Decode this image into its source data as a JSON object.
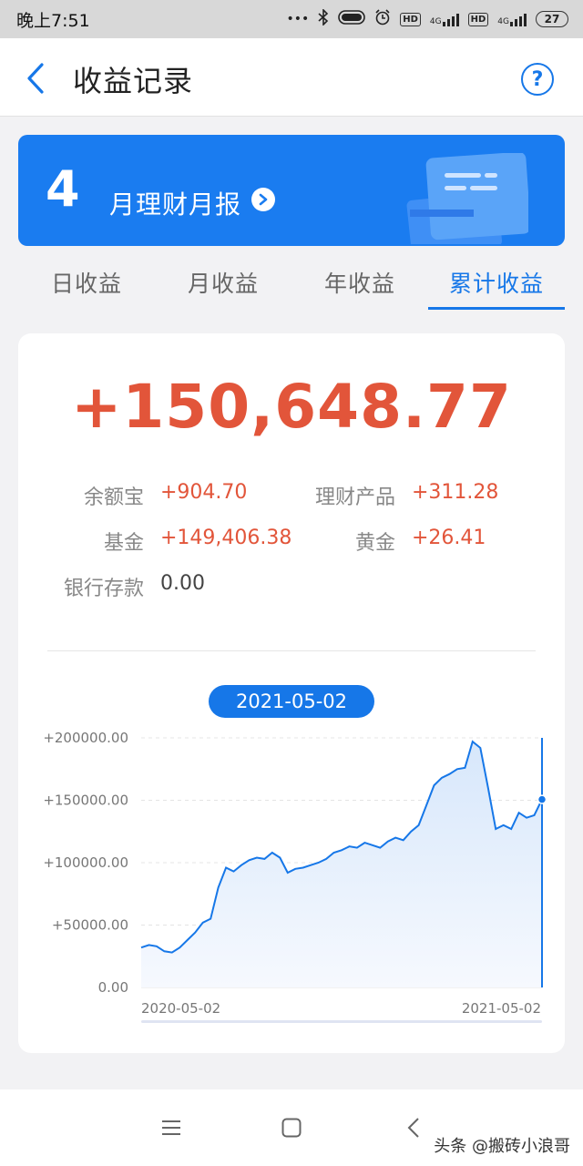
{
  "status_bar": {
    "time": "晚上7:51",
    "battery": "27",
    "network_1": "4G",
    "network_2": "4G",
    "hd_1": "HD",
    "hd_2": "HD"
  },
  "header": {
    "title": "收益记录",
    "help": "?"
  },
  "banner": {
    "month": "4",
    "title": "月理财月报"
  },
  "tabs": [
    {
      "label": "日收益",
      "active": false
    },
    {
      "label": "月收益",
      "active": false
    },
    {
      "label": "年收益",
      "active": false
    },
    {
      "label": "累计收益",
      "active": true
    }
  ],
  "summary": {
    "total": "+150,648.77",
    "items": [
      {
        "label": "余额宝",
        "value": "+904.70"
      },
      {
        "label": "理财产品",
        "value": "+311.28"
      },
      {
        "label": "基金",
        "value": "+149,406.38"
      },
      {
        "label": "黄金",
        "value": "+26.41"
      },
      {
        "label": "银行存款",
        "value": "0.00"
      }
    ]
  },
  "chart_data": {
    "type": "area",
    "selected_date": "2021-05-02",
    "x_start_label": "2020-05-02",
    "x_end_label": "2021-05-02",
    "y_ticks": [
      "0.00",
      "+50000.00",
      "+100000.00",
      "+150000.00",
      "+200000.00"
    ],
    "ylim": [
      0,
      200000
    ],
    "x": [
      "2020-05-02",
      "2020-05-09",
      "2020-05-16",
      "2020-05-23",
      "2020-05-30",
      "2020-06-06",
      "2020-06-13",
      "2020-06-20",
      "2020-06-27",
      "2020-07-04",
      "2020-07-11",
      "2020-07-18",
      "2020-07-25",
      "2020-08-01",
      "2020-08-08",
      "2020-08-15",
      "2020-08-22",
      "2020-08-29",
      "2020-09-05",
      "2020-09-12",
      "2020-09-19",
      "2020-09-26",
      "2020-10-03",
      "2020-10-10",
      "2020-10-17",
      "2020-10-24",
      "2020-10-31",
      "2020-11-07",
      "2020-11-14",
      "2020-11-21",
      "2020-11-28",
      "2020-12-05",
      "2020-12-12",
      "2020-12-19",
      "2020-12-26",
      "2021-01-02",
      "2021-01-09",
      "2021-01-16",
      "2021-01-23",
      "2021-01-30",
      "2021-02-06",
      "2021-02-13",
      "2021-02-20",
      "2021-02-27",
      "2021-03-06",
      "2021-03-13",
      "2021-03-20",
      "2021-03-27",
      "2021-04-03",
      "2021-04-10",
      "2021-04-17",
      "2021-04-24",
      "2021-05-02"
    ],
    "values": [
      32000,
      34000,
      33000,
      29000,
      28000,
      32000,
      38000,
      44000,
      52000,
      55000,
      80000,
      96000,
      93000,
      98000,
      102000,
      104000,
      103000,
      108000,
      104000,
      92000,
      95000,
      96000,
      98000,
      100000,
      103000,
      108000,
      110000,
      113000,
      112000,
      116000,
      114000,
      112000,
      117000,
      120000,
      118000,
      125000,
      130000,
      146000,
      162000,
      168000,
      171000,
      175000,
      176000,
      197000,
      192000,
      160000,
      127000,
      130000,
      127000,
      140000,
      136000,
      138000,
      150648
    ]
  },
  "nav": {
    "menu": "menu-icon",
    "home": "home-icon",
    "back": "back-icon"
  },
  "watermark": "头条 @搬砖小浪哥",
  "colors": {
    "accent": "#1677e8",
    "gain": "#e2553a",
    "banner": "#1a7cf0"
  }
}
